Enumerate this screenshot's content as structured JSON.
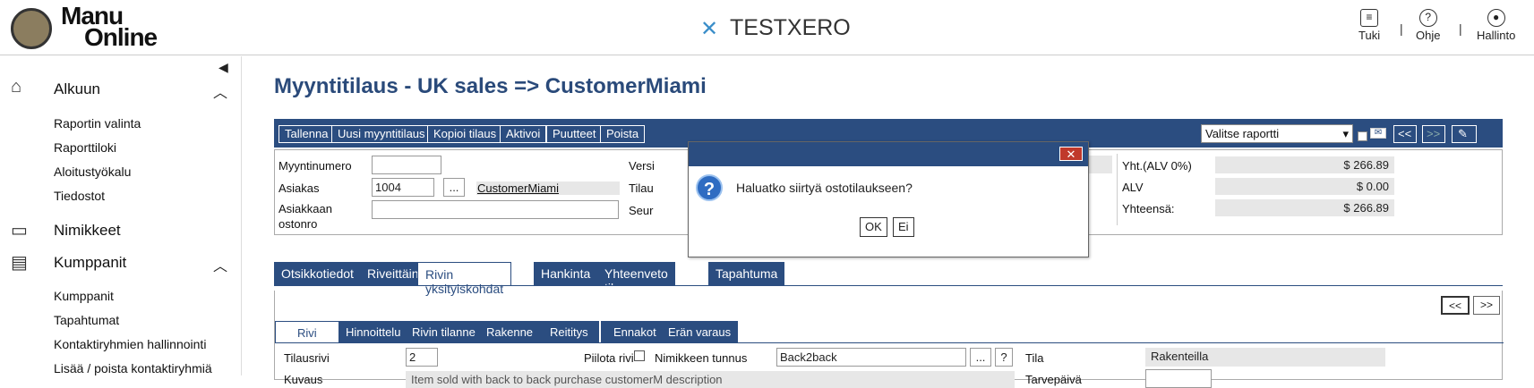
{
  "app": {
    "logo_line1": "Manu",
    "logo_line2": "Online",
    "company": "TESTXERO"
  },
  "toplinks": [
    {
      "label": "Tuki",
      "icon": "chat-icon"
    },
    {
      "label": "Ohje",
      "icon": "help-icon"
    },
    {
      "label": "Hallinto",
      "icon": "user-icon"
    }
  ],
  "sidebar": {
    "sections": [
      {
        "label": "Alkuun",
        "icon": "home-icon",
        "items": [
          "Raportin valinta",
          "Raporttiloki",
          "Aloitustyökalu",
          "Tiedostot"
        ]
      },
      {
        "label": "Nimikkeet",
        "icon": "inbox-icon",
        "items": []
      },
      {
        "label": "Kumppanit",
        "icon": "contacts-icon",
        "items": [
          "Kumppanit",
          "Tapahtumat",
          "Kontaktiryhmien hallinnointi",
          "Lisää / poista kontaktiryhmiä"
        ]
      }
    ]
  },
  "page": {
    "title": "Myyntitilaus - UK sales => CustomerMiami"
  },
  "toolbar": {
    "buttons": [
      "Tallenna",
      "Uusi myyntitilaus",
      "Kopioi tilaus",
      "Aktivoi",
      "Puutteet",
      "Poista"
    ],
    "report_select": "Valitse raportti",
    "prev": "<<",
    "next": ">>"
  },
  "form": {
    "myyntinumero_label": "Myyntinumero",
    "myyntinumero_value": "",
    "asiakas_label": "Asiakas",
    "asiakas_value": "1004",
    "asiakas_name": "CustomerMiami",
    "browse": "...",
    "ostonro_label1": "Asiakkaan",
    "ostonro_label2": "ostonro",
    "versio_label": "Versi",
    "tila_label": "Tilau",
    "seur_label": "Seur",
    "yht_label": "Yht.(ALV 0%)",
    "yht_value": "$ 266.89",
    "alv_label": "ALV",
    "alv_value": "$ 0.00",
    "total_label": "Yhteensä:",
    "total_value": "$ 266.89"
  },
  "tabs": [
    "Otsikkotiedot",
    "Riveittäin",
    "Rivin yksityiskohdat",
    "Hankinta",
    "Yhteenveto tilanne",
    "Tapahtuma"
  ],
  "subtabs": [
    "Rivi",
    "Hinnoittelu",
    "Rivin tilanne",
    "Rakenne",
    "Reititys",
    "Ennakot",
    "Erän varaus"
  ],
  "detail": {
    "prev": "<<",
    "next": ">>",
    "tilausrivi_label": "Tilausrivi",
    "tilausrivi_value": "2",
    "piilota_label": "Piilota rivi",
    "nimike_label": "Nimikkeen tunnus",
    "nimike_value": "Back2back",
    "browse": "...",
    "help": "?",
    "tila_label": "Tila",
    "tila_value": "Rakenteilla",
    "kuvaus_label": "Kuvaus",
    "kuvaus_value": "Item sold with back to back purchase customerM description",
    "tarvepaiva_label": "Tarvepäivä"
  },
  "dialog": {
    "close": "✕",
    "message": "Haluatko siirtyä ostotilaukseen?",
    "ok": "OK",
    "no": "Ei"
  }
}
